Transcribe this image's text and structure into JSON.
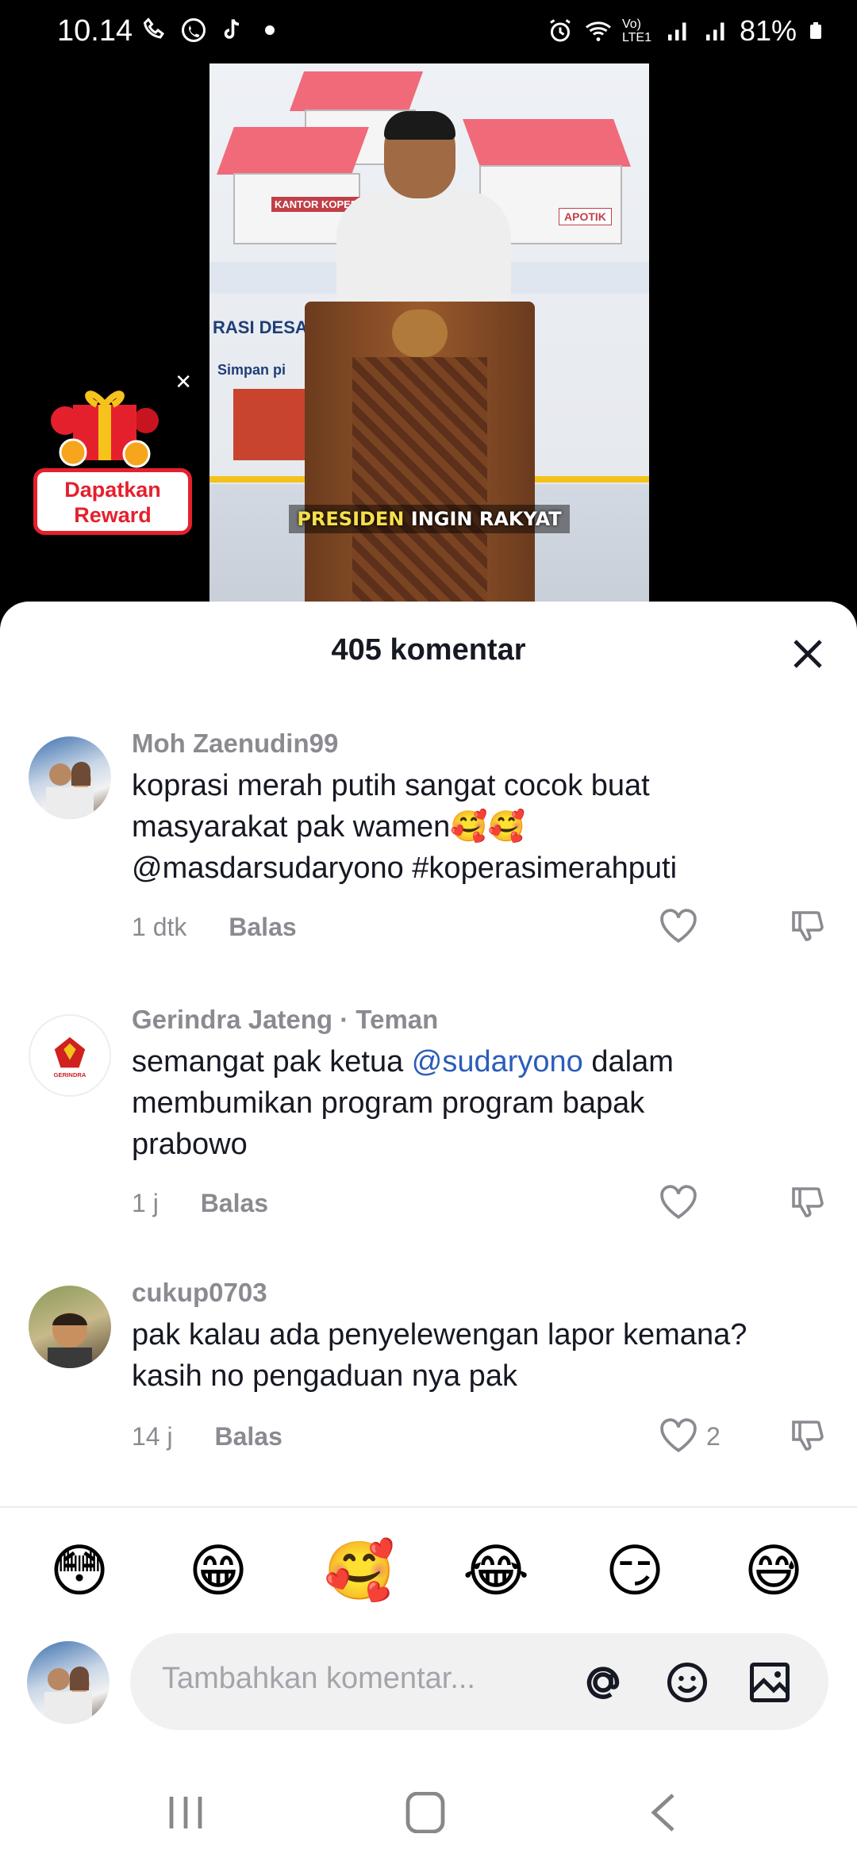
{
  "status_bar": {
    "time": "10.14",
    "battery": "81%",
    "network_label": "Vo) LTE1"
  },
  "video": {
    "caption_highlight": "PRESIDEN",
    "caption_rest": " INGIN RAKYAT",
    "sign_koperasi": "KANTOR KOPERASI",
    "sign_apotik": "APOTIK",
    "board_text_1": "RASI DESA",
    "board_text_2": "Simpan pi"
  },
  "reward": {
    "line1": "Dapatkan",
    "line2": "Reward"
  },
  "sheet": {
    "title": "405 komentar"
  },
  "comments": [
    {
      "username": "Moh Zaenudin99",
      "text_line1": "koprasi merah putih sangat cocok buat",
      "text_line2": "masyarakat pak wamen🥰🥰",
      "text_line3": "@masdarsudaryono #koperasimerahputi",
      "time": "1 dtk",
      "reply": "Balas"
    },
    {
      "username": "Gerindra Jateng · Teman",
      "text_pre": "semangat pak ketua ",
      "mention": "@sudaryono",
      "text_post": " dalam",
      "text_line2": "membumikan program program bapak",
      "text_line3": "prabowo",
      "time": "1 j",
      "reply": "Balas",
      "avatar_label": "GERINDRA"
    },
    {
      "username": "cukup0703",
      "text_line1": "pak kalau ada penyelewengan lapor kemana?",
      "text_line2": "kasih no pengaduan nya pak",
      "time": "14 j",
      "reply": "Balas",
      "likes": "2"
    }
  ],
  "emojis": [
    "😳",
    "😁",
    "🥰",
    "😂",
    "😏",
    "😅"
  ],
  "input": {
    "placeholder": "Tambahkan komentar..."
  },
  "colors": {
    "mention": "#2b5db9",
    "reward_red": "#e5202d",
    "caption_yellow": "#f6e04a"
  }
}
